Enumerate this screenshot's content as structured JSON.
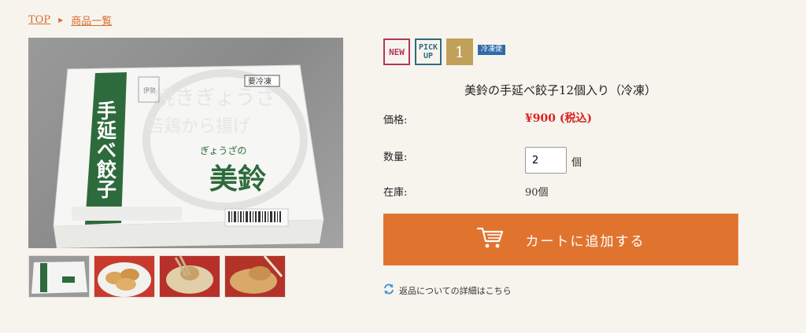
{
  "breadcrumb": {
    "home": "TOP",
    "category": "商品一覧"
  },
  "badges": {
    "new": "NEW",
    "pickup_line1": "PICK",
    "pickup_line2": "UP",
    "rank": "1",
    "frozen": "冷凍便"
  },
  "product": {
    "title": "美鈴の手延べ餃子12個入り（冷凍）",
    "price_label": "価格:",
    "price": "¥900 (税込)",
    "quantity_label": "数量:",
    "quantity_value": "2",
    "quantity_unit": "個",
    "stock_label": "在庫:",
    "stock_value": "90個"
  },
  "package": {
    "side_label": "手延べ餃子",
    "brand": "美鈴",
    "brand_small": "ぎょうざの",
    "frozen_tag": "要冷凍",
    "store_mark": "伊勢",
    "watermark1": "焼きぎょうざ",
    "watermark2": "若鶏から揚げ"
  },
  "cart": {
    "label": "カートに追加する"
  },
  "return_link": "返品についての詳細はこちら",
  "icons": {
    "cart": "cart-icon",
    "refresh": "refresh-icon",
    "breadcrumb_sep": "triangle-right-icon"
  },
  "colors": {
    "accent": "#e0742f",
    "price": "#dd2222",
    "new_badge": "#b1365d",
    "pickup_badge": "#2f6c7f",
    "rank_badge": "#c1a15a",
    "frozen_badge": "#2f6aa8",
    "package_green": "#2e6b3c"
  }
}
